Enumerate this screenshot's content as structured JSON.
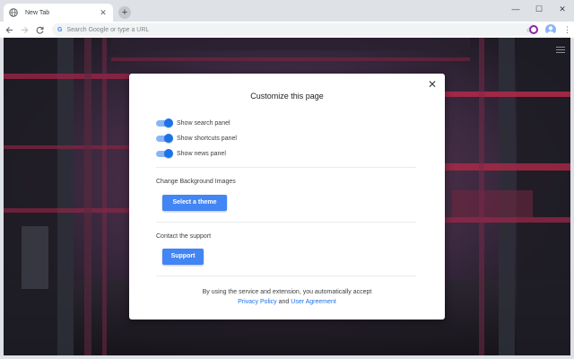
{
  "browser": {
    "tab": {
      "title": "New Tab",
      "favicon": "globe-icon",
      "close_glyph": "✕"
    },
    "new_tab_glyph": "+",
    "window_controls": [
      "—",
      "☐",
      "✕"
    ],
    "omnibox": {
      "google_glyph": "G",
      "placeholder": "Search Google or type a URL"
    }
  },
  "modal": {
    "title": "Customize this page",
    "close_glyph": "✕",
    "toggles": [
      {
        "label": "Show search panel",
        "on": true
      },
      {
        "label": "Show shortcuts panel",
        "on": true
      },
      {
        "label": "Show news panel",
        "on": true
      }
    ],
    "background_section": {
      "label": "Change Background Images",
      "button_label": "Select a theme"
    },
    "support_section": {
      "label": "Contact the support",
      "button_label": "Support"
    },
    "footer": {
      "text": "By using the service and extension, you automatically accept",
      "privacy_link": "Privacy Policy",
      "conjunction": "and",
      "agreement_link": "User Agreement"
    }
  },
  "colors": {
    "accent": "#4285f4",
    "toggle_on": "#1a73e8",
    "link": "#1a73e8",
    "backdrop_dark": "#241d2b",
    "backdrop_red": "#b5294a"
  }
}
